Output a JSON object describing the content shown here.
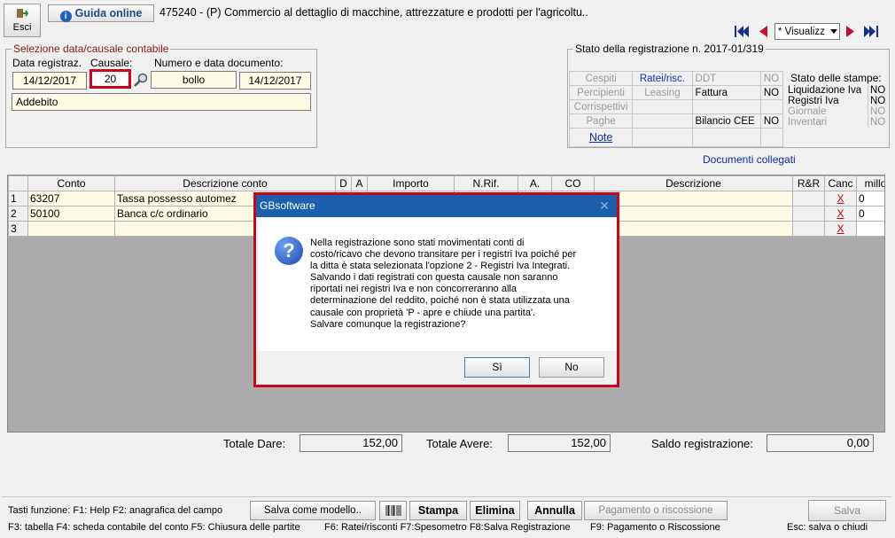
{
  "toolbar": {
    "exit_label": "Esci",
    "guide_label": "Guida online",
    "title": "475240 - (P) Commercio al dettaglio di macchine, attrezzature e prodotti per l'agricoltu..",
    "view_select": "* Visualizz"
  },
  "selezione": {
    "legend": "Selezione data/causale contabile",
    "date_label": "Data registraz.",
    "causale_label": "Causale:",
    "num_label": "Numero e data documento:",
    "date_value": "14/12/2017",
    "causale_value": "20",
    "num_value": "bollo",
    "doc_date_value": "14/12/2017",
    "descr_value": "Addebito"
  },
  "stato": {
    "title": "Stato della registrazione n. 2017-01/319",
    "rows": [
      [
        "Cespiti",
        "Ratei/risc.",
        "DDT",
        "NO"
      ],
      [
        "Percipienti",
        "Leasing",
        "Fattura",
        "NO"
      ],
      [
        "Corrispettivi",
        "",
        "",
        ""
      ],
      [
        "Paghe",
        "",
        "Bilancio CEE",
        "NO"
      ],
      [
        "Note",
        "",
        "",
        ""
      ]
    ],
    "stampe_title": "Stato delle stampe:",
    "stampe": [
      [
        "Liquidazione Iva",
        "NO"
      ],
      [
        "Registri Iva",
        "NO"
      ],
      [
        "Giornale",
        "NO"
      ],
      [
        "Inventari",
        "NO"
      ]
    ]
  },
  "documenti_collegati": "Documenti collegati",
  "grid": {
    "headers": [
      "",
      "Conto",
      "Descrizione conto",
      "D",
      "A",
      "Importo",
      "N.Rif.",
      "A.",
      "CO",
      "Descrizione",
      "R&R",
      "Canc",
      "millo"
    ],
    "rows": [
      {
        "n": "1",
        "conto": "63207",
        "descr": "Tassa possesso automez",
        "canc": "X",
        "millo": "0"
      },
      {
        "n": "2",
        "conto": "50100",
        "descr": "Banca c/c ordinario",
        "canc": "X",
        "millo": "0"
      },
      {
        "n": "3",
        "conto": "",
        "descr": "",
        "canc": "X",
        "millo": ""
      }
    ]
  },
  "totals": {
    "dare_label": "Totale Dare:",
    "dare_value": "152,00",
    "avere_label": "Totale Avere:",
    "avere_value": "152,00",
    "saldo_label": "Saldo registrazione:",
    "saldo_value": "0,00"
  },
  "bottom": {
    "line1": "Tasti funzione:  F1: Help  F2: anagrafica del campo",
    "save_model": "Salva come modello..",
    "stampa": "Stampa",
    "elimina": "Elimina",
    "annulla": "Annulla",
    "pagamento": "Pagamento o riscossione",
    "salva": "Salva",
    "line2a": "F3: tabella   F4: scheda contabile del conto  F5: Chiusura delle partite",
    "line2b": "F6: Ratei/risconti   F7:Spesometro   F8:Salva Registrazione",
    "line2c": "F9: Pagamento o Riscossione",
    "esc": "Esc: salva o chiudi"
  },
  "dialog": {
    "title": "GBsoftware",
    "message_lines": [
      "Nella registrazione sono stati movimentati conti di",
      "costo/ricavo che devono transitare per i registri Iva poiché per",
      "la ditta è stata selezionata l'opzione 2 - Registri Iva Integrati.",
      "Salvando i dati registrati con questa causale non saranno",
      "riportati nei registri Iva e non concorreranno alla",
      "determinazione del reddito, poiché non è stata utilizzata una",
      "causale con proprietà 'P - apre e chiude una partita'.",
      "Salvare comunque la registrazione?"
    ],
    "yes": "Sì",
    "no": "No"
  },
  "colors": {
    "highlight_red": "#d0021b",
    "field_yellow": "#fdfbe3",
    "dialog_title_blue": "#1b5fad",
    "grid_grey": "#ababab"
  }
}
